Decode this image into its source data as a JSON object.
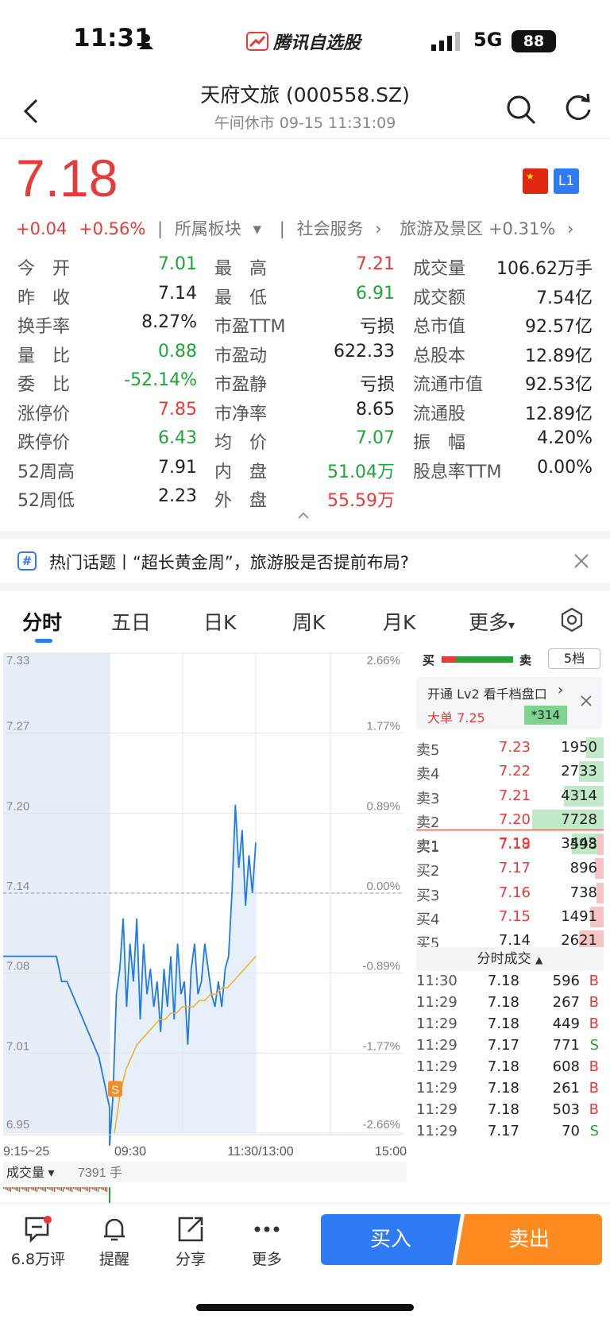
{
  "status_bar": {
    "time": "11:31",
    "app_name": "腾讯自选股",
    "network": "5G",
    "battery": "88"
  },
  "header": {
    "title": "天府文旅 (000558.SZ)",
    "subtitle": "午间休市   09-15 11:31:09"
  },
  "quote": {
    "price": "7.18",
    "change": "+0.04",
    "change_pct": "+0.56%",
    "sector_label": "所属板块",
    "sector1": "社会服务",
    "sector2": "旅游及景区 +0.31%",
    "badge": "L1"
  },
  "stats": {
    "col1": [
      {
        "label": "今　开",
        "value": "7.01",
        "color": "green"
      },
      {
        "label": "昨　收",
        "value": "7.14",
        "color": "dark"
      },
      {
        "label": "换手率",
        "value": "8.27%",
        "color": "dark"
      },
      {
        "label": "量　比",
        "value": "0.88",
        "color": "green"
      },
      {
        "label": "委　比",
        "value": "-52.14%",
        "color": "green"
      },
      {
        "label": "涨停价",
        "value": "7.85",
        "color": "red"
      },
      {
        "label": "跌停价",
        "value": "6.43",
        "color": "green"
      },
      {
        "label": "52周高",
        "value": "7.91",
        "color": "dark"
      },
      {
        "label": "52周低",
        "value": "2.23",
        "color": "dark"
      }
    ],
    "col2": [
      {
        "label": "最　高",
        "value": "7.21",
        "color": "red"
      },
      {
        "label": "最　低",
        "value": "6.91",
        "color": "green"
      },
      {
        "label": "市盈TTM",
        "value": "亏损",
        "color": "dark"
      },
      {
        "label": "市盈动",
        "value": "622.33",
        "color": "dark"
      },
      {
        "label": "市盈静",
        "value": "亏损",
        "color": "dark"
      },
      {
        "label": "市净率",
        "value": "8.65",
        "color": "dark"
      },
      {
        "label": "均　价",
        "value": "7.07",
        "color": "green"
      },
      {
        "label": "内　盘",
        "value": "51.04万",
        "color": "green"
      },
      {
        "label": "外　盘",
        "value": "55.59万",
        "color": "red"
      }
    ],
    "col3": [
      {
        "label": "成交量",
        "value": "106.62万手",
        "color": "dark"
      },
      {
        "label": "成交额",
        "value": "7.54亿",
        "color": "dark"
      },
      {
        "label": "总市值",
        "value": "92.57亿",
        "color": "dark"
      },
      {
        "label": "总股本",
        "value": "12.89亿",
        "color": "dark"
      },
      {
        "label": "流通市值",
        "value": "92.53亿",
        "color": "dark"
      },
      {
        "label": "流通股",
        "value": "12.89亿",
        "color": "dark"
      },
      {
        "label": "振　幅",
        "value": "4.20%",
        "color": "dark"
      },
      {
        "label": "股息率TTM",
        "value": "0.00%",
        "color": "dark"
      }
    ]
  },
  "topic": {
    "text": "热门话题丨“超长黄金周”，旅游股是否提前布局?"
  },
  "tabs": [
    "分时",
    "五日",
    "日K",
    "周K",
    "月K",
    "更多"
  ],
  "chart_data": {
    "type": "line",
    "y_labels": [
      "7.33",
      "7.27",
      "7.20",
      "7.14",
      "7.08",
      "7.01",
      "6.95"
    ],
    "pct_labels": [
      "2.66%",
      "1.77%",
      "0.89%",
      "0.00%",
      "-0.89%",
      "-1.77%",
      "-2.66%"
    ],
    "x_labels": [
      "9:15~25",
      "09:30",
      "11:30/13:00",
      "15:00"
    ],
    "prev_close": 7.14,
    "ylim": [
      6.95,
      7.33
    ],
    "price_series": [
      7.09,
      7.09,
      7.09,
      7.09,
      7.09,
      7.09,
      7.09,
      7.09,
      7.09,
      7.09,
      7.09,
      7.07,
      7.07,
      7.06,
      7.05,
      7.04,
      7.03,
      7.02,
      7.01,
      6.99,
      6.97,
      6.94,
      6.98,
      7.06,
      7.08,
      7.12,
      7.05,
      7.1,
      7.07,
      7.12,
      7.04,
      7.1,
      7.06,
      7.08,
      7.05,
      7.07,
      7.03,
      7.08,
      7.05,
      7.09,
      7.04,
      7.1,
      7.06,
      7.07,
      7.02,
      7.08,
      7.1,
      7.06,
      7.07,
      7.1,
      7.08,
      7.06,
      7.05,
      7.07,
      7.05,
      7.08,
      7.09,
      7.14,
      7.21,
      7.16,
      7.19,
      7.13,
      7.17,
      7.14,
      7.18
    ],
    "avg_series": [
      6.95,
      6.98,
      7.0,
      7.01,
      7.02,
      7.025,
      7.03,
      7.035,
      7.04,
      7.04,
      7.045,
      7.045,
      7.05,
      7.05,
      7.05,
      7.055,
      7.055,
      7.06,
      7.06,
      7.065,
      7.065,
      7.07,
      7.075,
      7.08,
      7.085,
      7.09
    ],
    "volume_label": "成交量",
    "volume_value": "7391 手"
  },
  "order_book": {
    "header_buy": "买",
    "header_sell": "卖",
    "levels_button": "5档",
    "promo_title": "开通 Lv2 看千档盘口",
    "promo_big_order": "大单 7.25",
    "promo_qty": "*314",
    "asks": [
      {
        "label": "卖5",
        "price": "7.23",
        "qty": "1950",
        "bar": 0.25
      },
      {
        "label": "卖4",
        "price": "7.22",
        "qty": "2733",
        "bar": 0.35
      },
      {
        "label": "卖3",
        "price": "7.21",
        "qty": "4314",
        "bar": 0.56
      },
      {
        "label": "卖2",
        "price": "7.20",
        "qty": "7728",
        "bar": 1.0
      },
      {
        "label": "卖1",
        "price": "7.19",
        "qty": "3443",
        "bar": 0.45
      }
    ],
    "bids": [
      {
        "label": "买1",
        "price": "7.18",
        "qty": "598",
        "bar": 0.08
      },
      {
        "label": "买2",
        "price": "7.17",
        "qty": "896",
        "bar": 0.12
      },
      {
        "label": "买3",
        "price": "7.16",
        "qty": "738",
        "bar": 0.1
      },
      {
        "label": "买4",
        "price": "7.15",
        "qty": "1491",
        "bar": 0.19
      },
      {
        "label": "买5",
        "price": "7.14",
        "qty": "2621",
        "bar": 0.34
      }
    ],
    "trades_title": "分时成交",
    "trades": [
      {
        "time": "11:30",
        "price": "7.18",
        "qty": "596",
        "side": "B"
      },
      {
        "time": "11:29",
        "price": "7.18",
        "qty": "267",
        "side": "B"
      },
      {
        "time": "11:29",
        "price": "7.18",
        "qty": "449",
        "side": "B"
      },
      {
        "time": "11:29",
        "price": "7.17",
        "qty": "771",
        "side": "S"
      },
      {
        "time": "11:29",
        "price": "7.18",
        "qty": "608",
        "side": "B"
      },
      {
        "time": "11:29",
        "price": "7.18",
        "qty": "261",
        "side": "B"
      },
      {
        "time": "11:29",
        "price": "7.18",
        "qty": "503",
        "side": "B"
      },
      {
        "time": "11:29",
        "price": "7.17",
        "qty": "70",
        "side": "S"
      }
    ]
  },
  "bottom_bar": {
    "comments": "6.8万评",
    "alert": "提醒",
    "share": "分享",
    "more": "更多",
    "buy": "买入",
    "sell": "卖出"
  },
  "colors": {
    "up": "#e63b3b",
    "down": "#22a33a",
    "accent": "#2f7bf5",
    "sell_button": "#ff8a1f"
  }
}
